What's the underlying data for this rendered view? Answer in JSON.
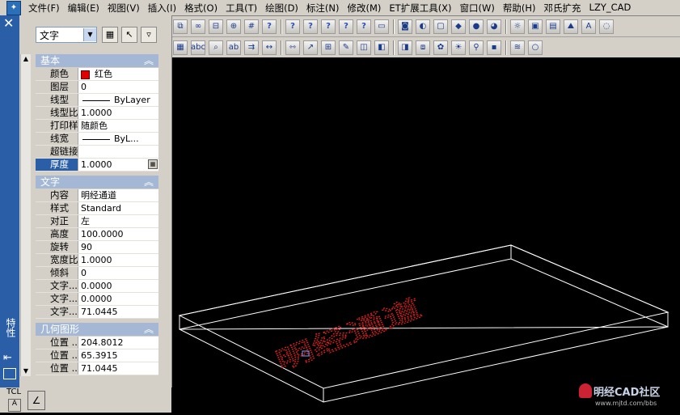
{
  "menubar": {
    "items": [
      "文件(F)",
      "编辑(E)",
      "视图(V)",
      "插入(I)",
      "格式(O)",
      "工具(T)",
      "绘图(D)",
      "标注(N)",
      "修改(M)",
      "ET扩展工具(X)",
      "窗口(W)",
      "帮助(H)",
      "邓氏扩充",
      "LZY_CAD"
    ]
  },
  "toolbar_icons": {
    "toolbar_row1": [
      "copy-icon",
      "link-icon",
      "xref-icon",
      "zoom-icon",
      "grid-icon",
      "query-icon",
      "query-icon",
      "query-icon",
      "query-icon",
      "query-icon",
      "query-icon",
      "ruler-icon",
      "camera-icon",
      "shade-icon",
      "box-icon",
      "cube-icon",
      "sphere-icon",
      "render-icon",
      "light-icon",
      "scene-icon",
      "material-icon",
      "landscape-icon",
      "text-icon",
      "bulb-icon"
    ],
    "toolbar_row2": [
      "block-icon",
      "spell-icon",
      "find-icon",
      "text-edit-icon",
      "match-icon",
      "dim-icon",
      "dim-edit-icon",
      "leader-icon",
      "tolerance-icon",
      "pen-icon",
      "style-icon",
      "layer-icon",
      "layer-prev-icon",
      "layer-state-icon",
      "color-icon",
      "sun-icon",
      "pin-icon",
      "lock-icon",
      "layers-icon",
      "bulb-small-icon"
    ]
  },
  "properties_palette": {
    "side_title": "特性",
    "object_type": "文字",
    "buttons": [
      "quick-select-icon",
      "select-objects-icon",
      "pickadd-icon"
    ],
    "sections": [
      {
        "title": "基本",
        "rows": [
          {
            "key": "颜色",
            "value": "红色",
            "swatch": "#e00000"
          },
          {
            "key": "图层",
            "value": "0"
          },
          {
            "key": "线型",
            "value": "ByLayer",
            "line": true
          },
          {
            "key": "线型比例",
            "value": "1.0000"
          },
          {
            "key": "打印样式",
            "value": "随颜色"
          },
          {
            "key": "线宽",
            "value": "ByL...",
            "line": true
          },
          {
            "key": "超链接",
            "value": ""
          },
          {
            "key": "厚度",
            "value": "1.0000",
            "selected": true
          }
        ]
      },
      {
        "title": "文字",
        "rows": [
          {
            "key": "内容",
            "value": "明经通道"
          },
          {
            "key": "样式",
            "value": "Standard"
          },
          {
            "key": "对正",
            "value": "左"
          },
          {
            "key": "高度",
            "value": "100.0000"
          },
          {
            "key": "旋转",
            "value": "90"
          },
          {
            "key": "宽度比例",
            "value": "1.0000"
          },
          {
            "key": "倾斜",
            "value": "0"
          },
          {
            "key": "文字...",
            "value": "0.0000"
          },
          {
            "key": "文字...",
            "value": "0.0000"
          },
          {
            "key": "文字...",
            "value": "71.0445"
          }
        ]
      },
      {
        "title": "几何图形",
        "rows": [
          {
            "key": "位置 ...",
            "value": "204.8012"
          },
          {
            "key": "位置 ...",
            "value": "65.3915"
          },
          {
            "key": "位置 ...",
            "value": "71.0445"
          }
        ]
      }
    ]
  },
  "drawing": {
    "text": "明经通道",
    "text_color": "#e02020",
    "box_color": "#ffffff"
  },
  "command_panel": {
    "label": "TCL"
  },
  "watermark": {
    "title": "明经CAD社区",
    "url": "www.mjtd.com/bbs"
  }
}
